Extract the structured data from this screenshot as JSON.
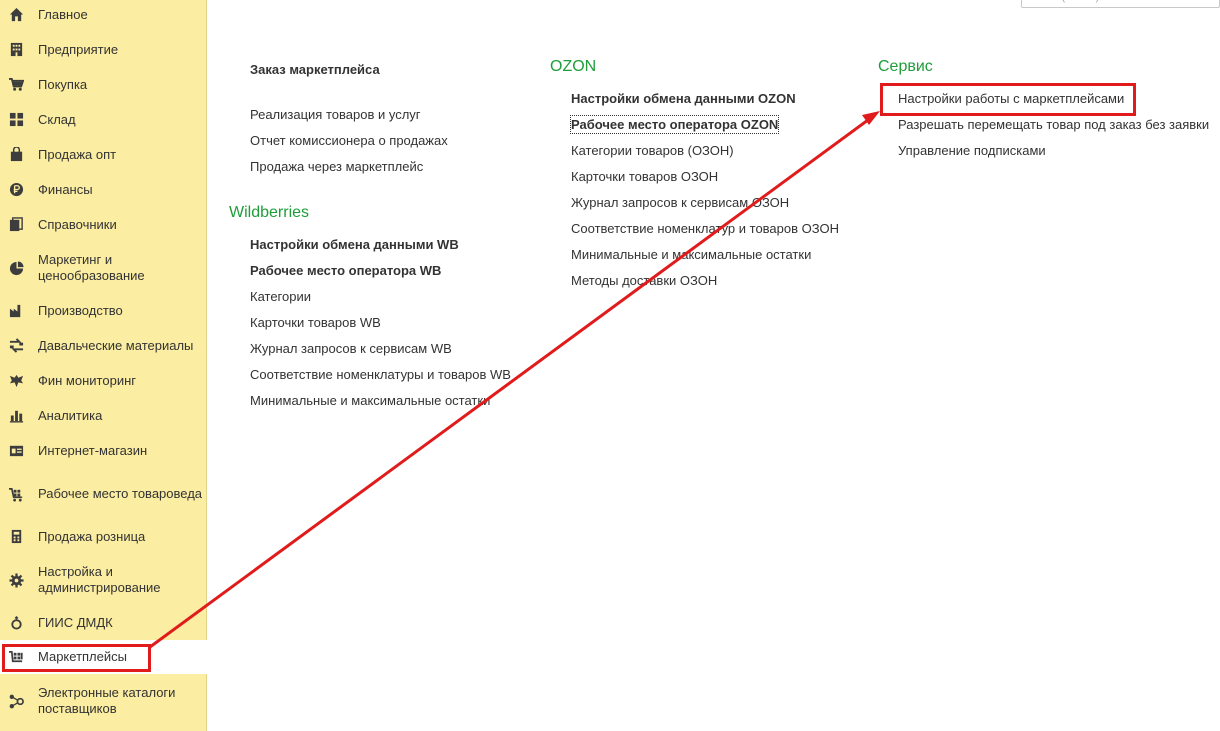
{
  "search": {
    "placeholder": "Поиск (Ctrl+F)"
  },
  "sidebar": {
    "items": [
      {
        "label": "Главное",
        "icon": "home-icon"
      },
      {
        "label": "Предприятие",
        "icon": "building-icon"
      },
      {
        "label": "Покупка",
        "icon": "cart-icon"
      },
      {
        "label": "Склад",
        "icon": "grid-icon"
      },
      {
        "label": "Продажа опт",
        "icon": "bag-icon"
      },
      {
        "label": "Финансы",
        "icon": "ruble-coin-icon"
      },
      {
        "label": "Справочники",
        "icon": "books-icon"
      },
      {
        "label": "Маркетинг и ценообразование",
        "icon": "pie-chart-icon"
      },
      {
        "label": "Производство",
        "icon": "factory-icon"
      },
      {
        "label": "Давальческие материалы",
        "icon": "exchange-icon"
      },
      {
        "label": "Фин мониторинг",
        "icon": "eagle-emblem-icon"
      },
      {
        "label": "Аналитика",
        "icon": "bar-chart-icon"
      },
      {
        "label": "Интернет-магазин",
        "icon": "id-card-icon"
      },
      {
        "label": "Рабочее место товароведа",
        "icon": "cart-grid-icon"
      },
      {
        "label": "Продажа розница",
        "icon": "cash-register-icon"
      },
      {
        "label": "Настройка и администрирование",
        "icon": "gear-icon"
      },
      {
        "label": "ГИИС ДМДК",
        "icon": "ring-icon"
      },
      {
        "label": "Маркетплейсы",
        "icon": "marketplace-icon"
      },
      {
        "label": "Электронные каталоги поставщиков",
        "icon": "network-icon"
      }
    ]
  },
  "main": {
    "col1": {
      "top_links": [
        {
          "label": "Заказ маркетплейса",
          "bold": true
        },
        {
          "label": "Реализация товаров и услуг",
          "bold": false
        },
        {
          "label": "Отчет комиссионера о продажах",
          "bold": false
        },
        {
          "label": "Продажа через маркетплейс",
          "bold": false
        }
      ],
      "wb_title": "Wildberries",
      "wb_links": [
        {
          "label": "Настройки обмена данными WB",
          "bold": true
        },
        {
          "label": "Рабочее место оператора WB",
          "bold": true
        },
        {
          "label": "Категории",
          "bold": false
        },
        {
          "label": "Карточки товаров WB",
          "bold": false
        },
        {
          "label": "Журнал запросов к сервисам WB",
          "bold": false
        },
        {
          "label": "Соответствие номенклатуры и товаров WB",
          "bold": false
        },
        {
          "label": "Минимальные и максимальные остатки",
          "bold": false
        }
      ]
    },
    "ozon": {
      "title": "OZON",
      "links": [
        {
          "label": "Настройки обмена данными OZON",
          "bold": true
        },
        {
          "label": "Рабочее место оператора OZON",
          "bold": true
        },
        {
          "label": "Категории товаров (ОЗОН)",
          "bold": false
        },
        {
          "label": "Карточки товаров ОЗОН",
          "bold": false
        },
        {
          "label": "Журнал запросов к сервисам ОЗОН",
          "bold": false
        },
        {
          "label": "Соответствие номенклатур и товаров ОЗОН",
          "bold": false
        },
        {
          "label": "Минимальные и максимальные остатки",
          "bold": false
        },
        {
          "label": "Методы доставки ОЗОН",
          "bold": false
        }
      ]
    },
    "service": {
      "title": "Сервис",
      "links": [
        {
          "label": "Настройки работы с маркетплейсами",
          "bold": false
        },
        {
          "label": "Разрешать перемещать товар под заказ без заявки",
          "bold": false
        },
        {
          "label": "Управление подписками",
          "bold": false
        }
      ]
    }
  },
  "colors": {
    "sidebar_bg": "#fbeda2",
    "section_title": "#1f9d3a",
    "annotation": "#e11b1b"
  }
}
